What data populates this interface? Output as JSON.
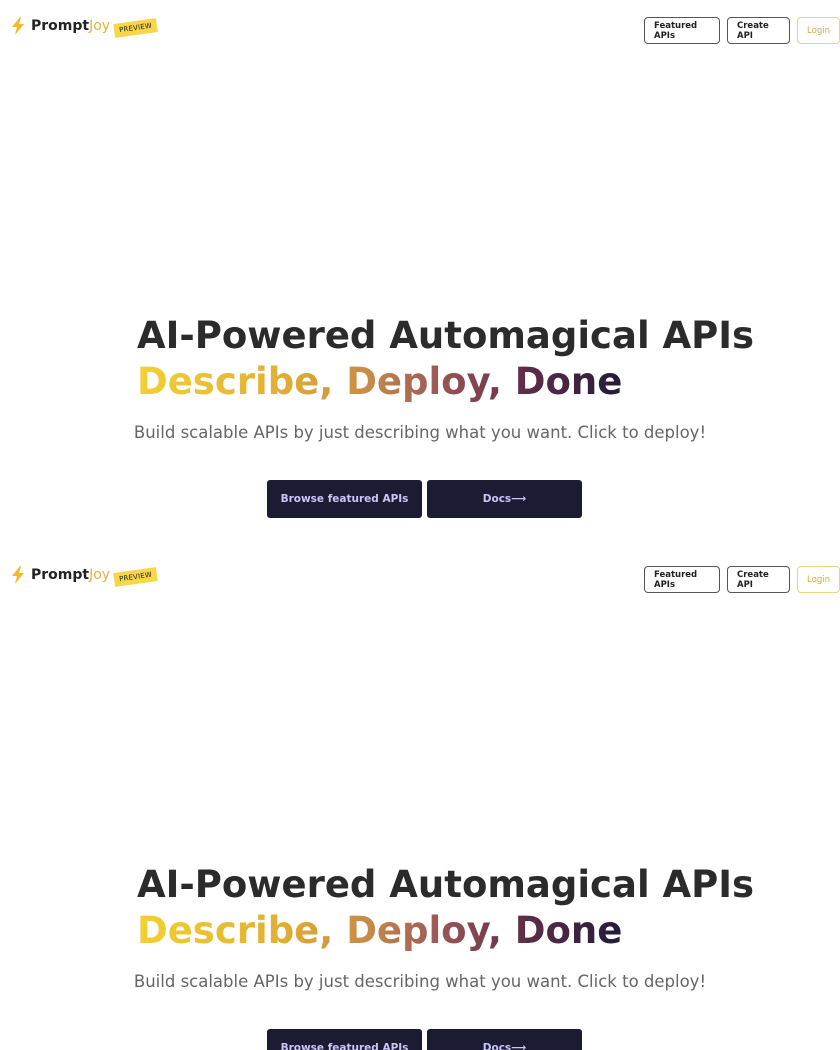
{
  "brand": {
    "prefix": "Prompt",
    "suffix": "Joy",
    "badge": "PREVIEW",
    "icon": "lightning-bolt-icon",
    "accent_color": "#e0b33a"
  },
  "nav": {
    "featured_label": "Featured APIs",
    "create_label": "Create API",
    "login_label": "Login"
  },
  "hero": {
    "headline": "AI-Powered Automagical APIs",
    "tagline": "Describe, Deploy, Done",
    "subtitle": "Build scalable APIs by just describing what you want. Click to deploy!",
    "browse_label": "Browse featured APIs",
    "docs_label": "Docs⟶"
  },
  "colors": {
    "gradient": [
      "#f2d132",
      "#e1ae35",
      "#c68a49",
      "#9c5757",
      "#5e2d47",
      "#231b3a"
    ],
    "button_bg": "#1b1b33",
    "button_text": "#c9c6f7"
  }
}
